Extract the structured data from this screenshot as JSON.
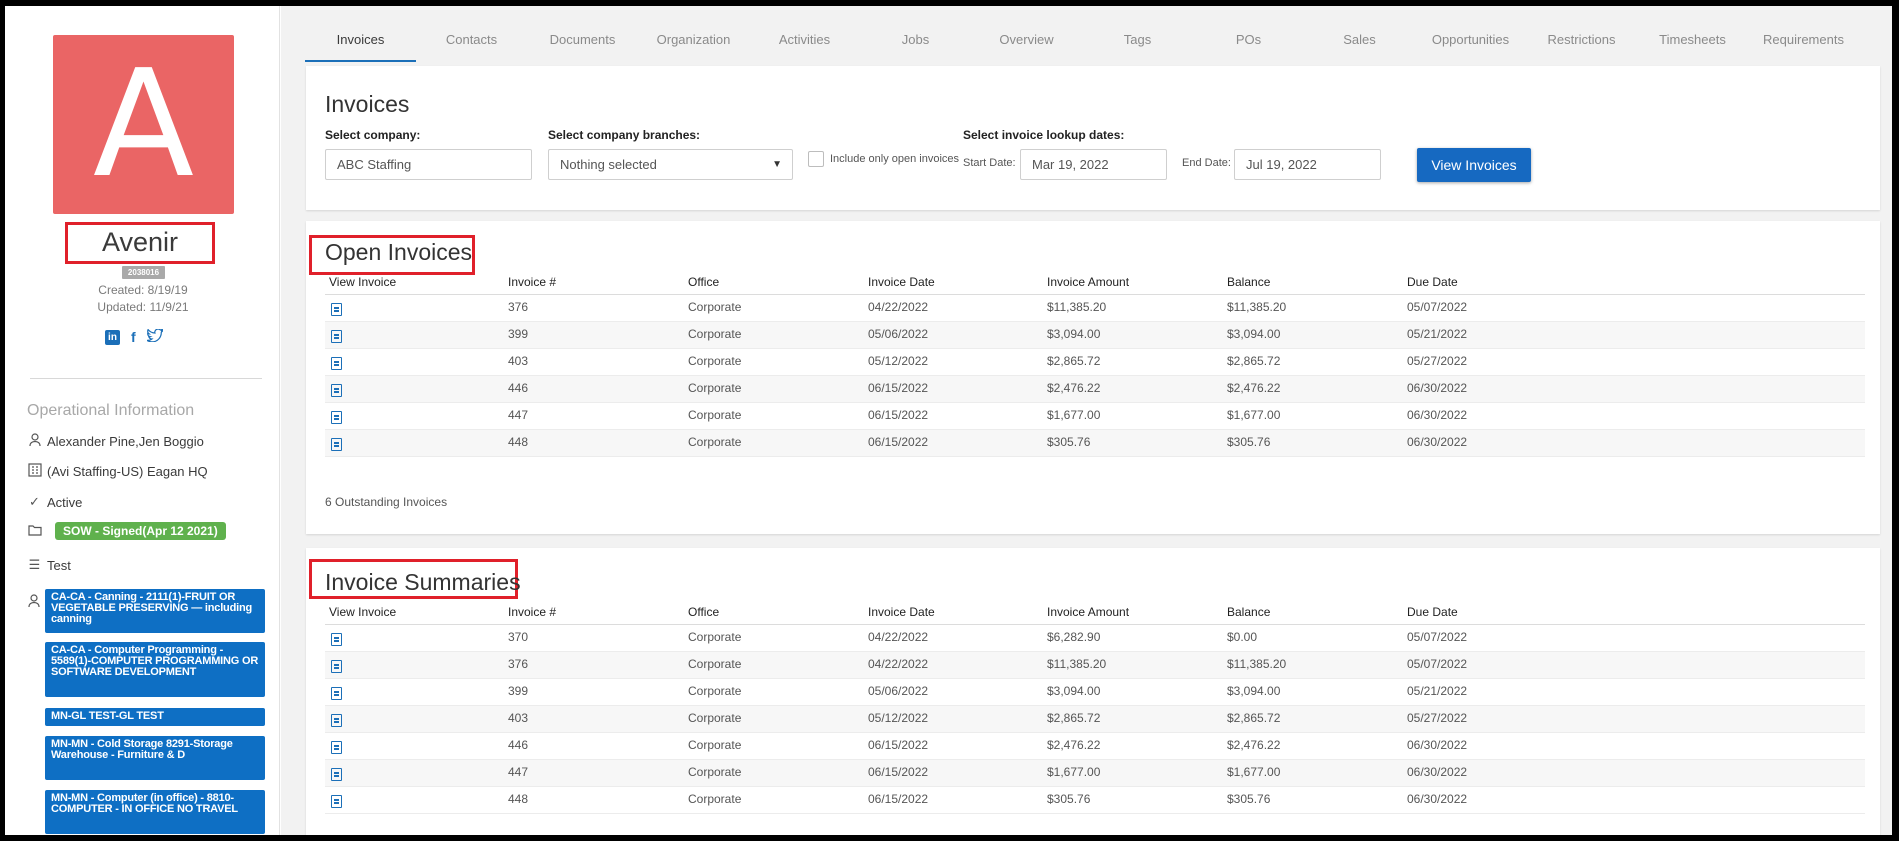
{
  "sidebar": {
    "avatar_letter": "A",
    "name": "Avenir",
    "id_badge": "2038016",
    "created": "Created: 8/19/19",
    "updated": "Updated: 11/9/21",
    "social": [
      "linkedin-icon",
      "facebook-icon",
      "twitter-icon"
    ],
    "operational_title": "Operational Information",
    "owners": "Alexander Pine,Jen Boggio",
    "office": "(Avi Staffing-US) Eagan HQ",
    "status": "Active",
    "sow": "SOW - Signed(Apr 12 2021)",
    "list": "Test",
    "tags": [
      "CA-CA - Canning - 2111(1)-FRUIT OR VEGETABLE PRESERVING — including canning",
      "CA-CA - Computer Programming - 5589(1)-COMPUTER PROGRAMMING OR SOFTWARE DEVELOPMENT",
      "MN-GL TEST-GL TEST",
      "MN-MN - Cold Storage 8291-Storage Warehouse - Furniture & D",
      "MN-MN - Computer (in office) - 8810-COMPUTER - IN OFFICE NO TRAVEL"
    ]
  },
  "tabs": [
    "Invoices",
    "Contacts",
    "Documents",
    "Organization",
    "Activities",
    "Jobs",
    "Overview",
    "Tags",
    "POs",
    "Sales",
    "Opportunities",
    "Restrictions",
    "Timesheets",
    "Requirements"
  ],
  "invoices_panel": {
    "title": "Invoices",
    "company_label": "Select company:",
    "company_value": "ABC Staffing",
    "branches_label": "Select company branches:",
    "branches_value": "Nothing selected",
    "open_only_label": "Include only open invoices",
    "dates_label": "Select invoice lookup dates:",
    "start_label": "Start Date:",
    "start_value": "Mar 19, 2022",
    "end_label": "End Date:",
    "end_value": "Jul 19, 2022",
    "view_button": "View Invoices"
  },
  "columns": [
    "View Invoice",
    "Invoice #",
    "Office",
    "Invoice Date",
    "Invoice Amount",
    "Balance",
    "Due Date"
  ],
  "open_invoices": {
    "title": "Open Invoices",
    "rows": [
      [
        "376",
        "Corporate",
        "04/22/2022",
        "$11,385.20",
        "$11,385.20",
        "05/07/2022"
      ],
      [
        "399",
        "Corporate",
        "05/06/2022",
        "$3,094.00",
        "$3,094.00",
        "05/21/2022"
      ],
      [
        "403",
        "Corporate",
        "05/12/2022",
        "$2,865.72",
        "$2,865.72",
        "05/27/2022"
      ],
      [
        "446",
        "Corporate",
        "06/15/2022",
        "$2,476.22",
        "$2,476.22",
        "06/30/2022"
      ],
      [
        "447",
        "Corporate",
        "06/15/2022",
        "$1,677.00",
        "$1,677.00",
        "06/30/2022"
      ],
      [
        "448",
        "Corporate",
        "06/15/2022",
        "$305.76",
        "$305.76",
        "06/30/2022"
      ]
    ],
    "footer": "6 Outstanding Invoices"
  },
  "invoice_summaries": {
    "title": "Invoice Summaries",
    "rows": [
      [
        "370",
        "Corporate",
        "04/22/2022",
        "$6,282.90",
        "$0.00",
        "05/07/2022"
      ],
      [
        "376",
        "Corporate",
        "04/22/2022",
        "$11,385.20",
        "$11,385.20",
        "05/07/2022"
      ],
      [
        "399",
        "Corporate",
        "05/06/2022",
        "$3,094.00",
        "$3,094.00",
        "05/21/2022"
      ],
      [
        "403",
        "Corporate",
        "05/12/2022",
        "$2,865.72",
        "$2,865.72",
        "05/27/2022"
      ],
      [
        "446",
        "Corporate",
        "06/15/2022",
        "$2,476.22",
        "$2,476.22",
        "06/30/2022"
      ],
      [
        "447",
        "Corporate",
        "06/15/2022",
        "$1,677.00",
        "$1,677.00",
        "06/30/2022"
      ],
      [
        "448",
        "Corporate",
        "06/15/2022",
        "$305.76",
        "$305.76",
        "06/30/2022"
      ]
    ]
  },
  "colors": {
    "accent": "#1b6fb8",
    "button": "#1669c1",
    "avatar": "#ea6565",
    "tag": "#0e6fc4",
    "sow_badge": "#5fb14d",
    "highlight_box": "#e0202a"
  }
}
